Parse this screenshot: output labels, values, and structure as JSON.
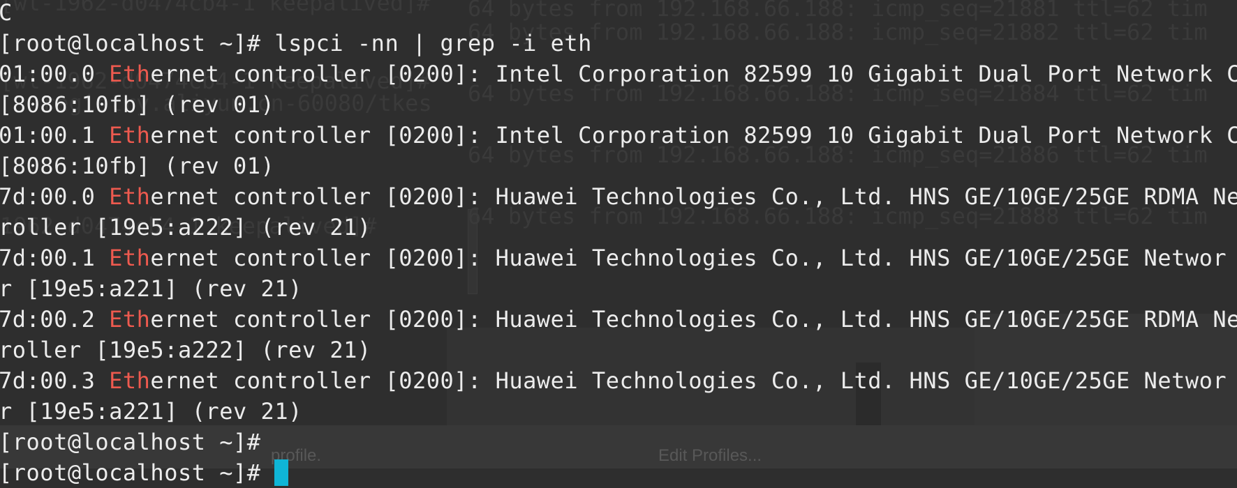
{
  "colors": {
    "background": "#2e2e2e",
    "text": "#ececec",
    "match_highlight": "#ee5a4f",
    "cursor": "#0fb5d6"
  },
  "terminal": {
    "lines": [
      {
        "text": "C"
      },
      {
        "text": "[root@localhost ~]# lspci -nn | grep -i eth"
      },
      {
        "pre": "01:00.0 ",
        "match": "Eth",
        "post": "ernet controller [0200]: Intel Corporation 82599 10 Gigabit Dual Port Network C"
      },
      {
        "text": "[8086:10fb] (rev 01)"
      },
      {
        "pre": "01:00.1 ",
        "match": "Eth",
        "post": "ernet controller [0200]: Intel Corporation 82599 10 Gigabit Dual Port Network C"
      },
      {
        "text": "[8086:10fb] (rev 01)"
      },
      {
        "pre": "7d:00.0 ",
        "match": "Eth",
        "post": "ernet controller [0200]: Huawei Technologies Co., Ltd. HNS GE/10GE/25GE RDMA Ne"
      },
      {
        "text": "roller [19e5:a222] (rev 21)"
      },
      {
        "pre": "7d:00.1 ",
        "match": "Eth",
        "post": "ernet controller [0200]: Huawei Technologies Co., Ltd. HNS GE/10GE/25GE Networ"
      },
      {
        "text": "r [19e5:a221] (rev 21)"
      },
      {
        "pre": "7d:00.2 ",
        "match": "Eth",
        "post": "ernet controller [0200]: Huawei Technologies Co., Ltd. HNS GE/10GE/25GE RDMA Ne"
      },
      {
        "text": "roller [19e5:a222] (rev 21)"
      },
      {
        "pre": "7d:00.3 ",
        "match": "Eth",
        "post": "ernet controller [0200]: Huawei Technologies Co., Ltd. HNS GE/10GE/25GE Networ"
      },
      {
        "text": "r [19e5:a221] (rev 21)"
      },
      {
        "text": "[root@localhost ~]#"
      },
      {
        "text": "[root@localhost ~]# "
      }
    ]
  },
  "background_window": {
    "lines": [
      "64 bytes from 192.168.66.188: icmp_seq=21881 ttl=62 tim",
      "64 bytes from 192.168.66.188: icmp_seq=21882 ttl=62 tim",
      "64 bytes from 192.168.66.188: icmp_seq=21884 ttl=62 tim",
      "64 bytes from 192.168.66.188: icmp_seq=21886 ttl=62 tim",
      "64 bytes from 192.168.66.188: icmp_seq=21888 ttl=62 tim"
    ],
    "left_fragments": [
      "[wl-1962-d0474cb4-1 keepalived]#",
      "[wl-1962-d0474cb4-1 keepalived]#",
      "registry.aliyun.cn-60080/tkes",
      "1962-d0474cb4-1 keepalived]#"
    ],
    "edit_profiles_label": "Edit Profiles...",
    "profile_label": "profile."
  }
}
